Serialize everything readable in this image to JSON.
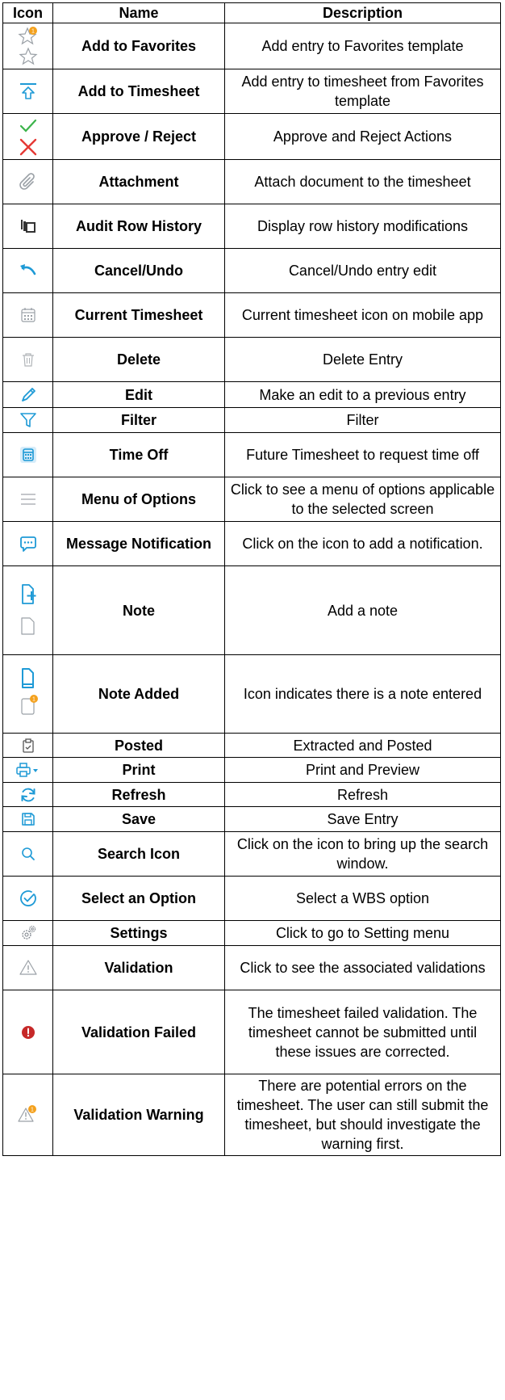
{
  "header": {
    "icon": "Icon",
    "name": "Name",
    "description": "Description"
  },
  "rows": [
    {
      "icon": "favorite-star-icon",
      "name": "Add to Favorites",
      "description": "Add entry to Favorites template"
    },
    {
      "icon": "add-to-timesheet-icon",
      "name": "Add to Timesheet",
      "description": "Add entry to timesheet from Favorites template"
    },
    {
      "icon": "approve-reject-icon",
      "name": "Approve / Reject",
      "description": "Approve and Reject Actions"
    },
    {
      "icon": "paperclip-icon",
      "name": "Attachment",
      "description": "Attach document to the timesheet"
    },
    {
      "icon": "audit-history-icon",
      "name": "Audit Row History",
      "description": "Display row history modifications"
    },
    {
      "icon": "undo-icon",
      "name": "Cancel/Undo",
      "description": "Cancel/Undo entry edit"
    },
    {
      "icon": "calendar-icon",
      "name": "Current Timesheet",
      "description": "Current timesheet icon on mobile app"
    },
    {
      "icon": "trash-icon",
      "name": "Delete",
      "description": "Delete Entry"
    },
    {
      "icon": "pencil-icon",
      "name": "Edit",
      "description": "Make an edit to a previous entry"
    },
    {
      "icon": "filter-icon",
      "name": "Filter",
      "description": "Filter"
    },
    {
      "icon": "time-off-calendar-icon",
      "name": "Time Off",
      "description": "Future Timesheet to request time off"
    },
    {
      "icon": "hamburger-menu-icon",
      "name": "Menu of Options",
      "description": "Click to see a menu of options applicable to the selected screen"
    },
    {
      "icon": "message-bubble-icon",
      "name": "Message Notification",
      "description": "Click on the icon to add a notification."
    },
    {
      "icon": "note-add-icon",
      "name": "Note",
      "description": "Add a note"
    },
    {
      "icon": "note-added-icon",
      "name": "Note Added",
      "description": "Icon indicates there is a note entered"
    },
    {
      "icon": "posted-clipboard-icon",
      "name": "Posted",
      "description": "Extracted and Posted"
    },
    {
      "icon": "printer-icon",
      "name": "Print",
      "description": "Print and Preview"
    },
    {
      "icon": "refresh-icon",
      "name": "Refresh",
      "description": "Refresh"
    },
    {
      "icon": "save-floppy-icon",
      "name": "Save",
      "description": "Save Entry"
    },
    {
      "icon": "search-icon",
      "name": "Search Icon",
      "description": "Click on the icon to bring up the search window."
    },
    {
      "icon": "check-circle-icon",
      "name": "Select an Option",
      "description": "Select a  WBS option"
    },
    {
      "icon": "gear-icon",
      "name": "Settings",
      "description": "Click to go to Setting menu"
    },
    {
      "icon": "warning-triangle-icon",
      "name": "Validation",
      "description": "Click to see the associated validations"
    },
    {
      "icon": "error-circle-icon",
      "name": "Validation Failed",
      "description": "The timesheet failed validation. The timesheet cannot be submitted until these issues are corrected."
    },
    {
      "icon": "warning-badge-icon",
      "name": "Validation Warning",
      "description": "There are potential errors on the timesheet. The user can still submit the timesheet, but should investigate the warning first."
    }
  ],
  "badge_text": "1",
  "colors": {
    "blue": "#1e9ad6",
    "gray": "#9aa0a6",
    "green": "#3cb44b",
    "red": "#e53935",
    "orange": "#f4a11d",
    "dark_red": "#c62828"
  }
}
